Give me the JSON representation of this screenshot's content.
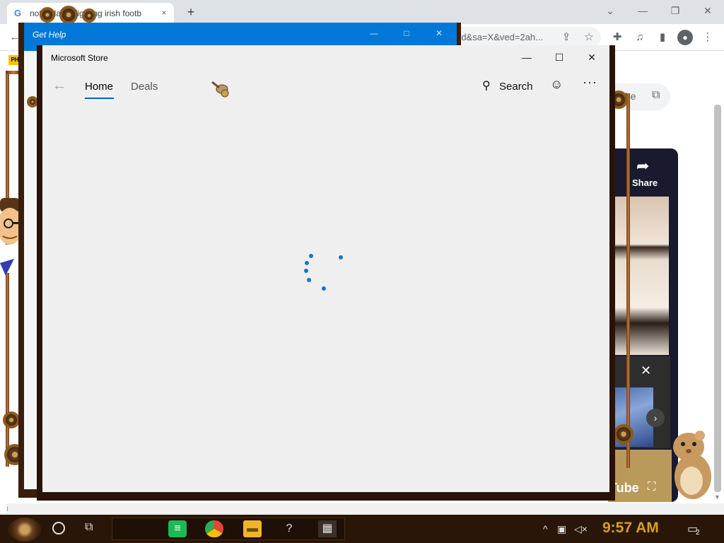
{
  "browser": {
    "tab_title": "notre dame fighting irish footb",
    "tab_favicon": "G",
    "tab_close": "×",
    "new_tab": "+",
    "url_fragment": "rd&sa=X&ved=2ah...",
    "window_controls": {
      "minimize": "—",
      "restore": "❐",
      "close": "✕",
      "dropdown": "⌄"
    }
  },
  "background_page": {
    "ext_link_text": "be",
    "yt_share_label": "Share",
    "yt_logo": "Tube",
    "yt_close": "✕",
    "yt_next": "›",
    "left_label": "PH"
  },
  "back_window": {
    "title": "Get Help",
    "controls": {
      "minimize": "—",
      "maximize": "□",
      "close": "✕"
    }
  },
  "store": {
    "title": "Microsoft Store",
    "controls": {
      "minimize": "—",
      "maximize": "☐",
      "close": "✕"
    },
    "nav": {
      "home": "Home",
      "deals": "Deals"
    },
    "search_label": "Search",
    "more": "···",
    "loading": true
  },
  "taskbar": {
    "clock": "9:57 AM",
    "notification_count": "2"
  },
  "colors": {
    "store_bg": "#efefef",
    "accent": "#0067c0",
    "spinner": "#1a73c8",
    "back_window_titlebar": "#0078d7",
    "taskbar": "#2a1608",
    "clock": "#d4a020"
  }
}
